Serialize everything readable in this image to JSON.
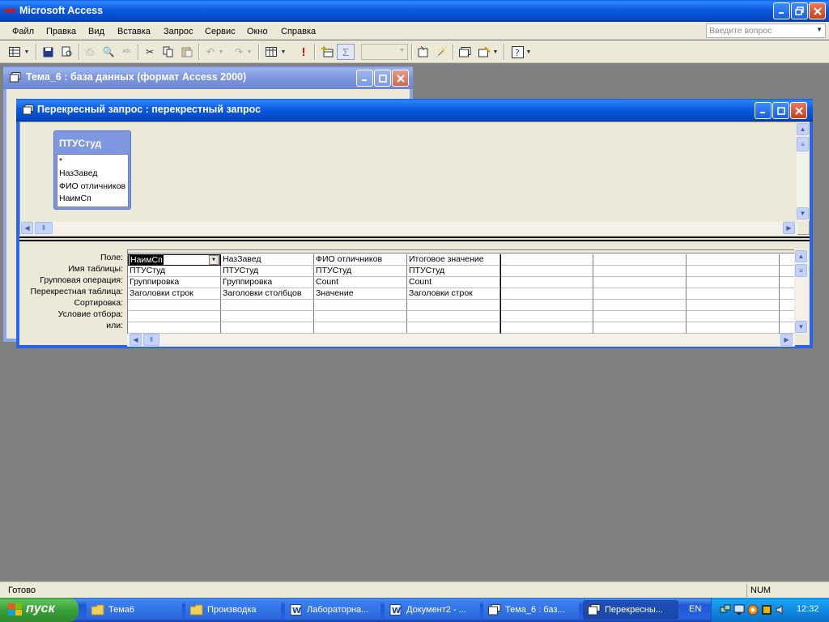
{
  "app": {
    "title": "Microsoft Access"
  },
  "menu": {
    "items": [
      "Файл",
      "Правка",
      "Вид",
      "Вставка",
      "Запрос",
      "Сервис",
      "Окно",
      "Справка"
    ],
    "help_placeholder": "Введите вопрос"
  },
  "db_window": {
    "title": "Тема_6 : база данных (формат Access 2000)"
  },
  "query_window": {
    "title": "Перекресный запрос : перекрестный запрос"
  },
  "table_box": {
    "title": "ПТУСтуд",
    "fields": [
      "*",
      "НазЗавед",
      "ФИО отличников",
      "НаимСп"
    ]
  },
  "grid": {
    "row_labels": [
      "Поле:",
      "Имя таблицы:",
      "Групповая операция:",
      "Перекрестная таблица:",
      "Сортировка:",
      "Условие отбора:",
      "или:"
    ],
    "columns": [
      [
        "НаимСп",
        "ПТУСтуд",
        "Группировка",
        "Заголовки строк"
      ],
      [
        "НазЗавед",
        "ПТУСтуд",
        "Группировка",
        "Заголовки столбцов"
      ],
      [
        "ФИО отличников",
        "ПТУСтуд",
        "Count",
        "Значение"
      ],
      [
        "Итоговое значение",
        "ПТУСтуд",
        "Count",
        "Заголовки строк"
      ]
    ]
  },
  "status": {
    "left": "Готово",
    "num": "NUM"
  },
  "taskbar": {
    "start": "пуск",
    "items": [
      "Тема6",
      "Производка",
      "Лабораторна...",
      "Документ2 - ...",
      "Тема_6 : баз...",
      "Перекресны..."
    ],
    "lang": "EN",
    "clock": "12:32"
  }
}
